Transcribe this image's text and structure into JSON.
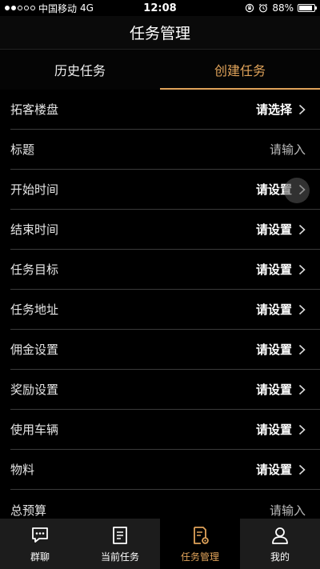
{
  "status_bar": {
    "carrier": "中国移动",
    "network": "4G",
    "time": "12:08",
    "battery": "88%",
    "battery_level": 0.88
  },
  "nav": {
    "title": "任务管理"
  },
  "tabs": [
    {
      "label": "历史任务",
      "active": false
    },
    {
      "label": "创建任务",
      "active": true
    }
  ],
  "accent_color": "#e0a35a",
  "form": {
    "rows": [
      {
        "label": "拓客楼盘",
        "value": "请选择",
        "kind": "select"
      },
      {
        "label": "标题",
        "value": "请输入",
        "kind": "input"
      },
      {
        "label": "开始时间",
        "value": "请设置",
        "kind": "select"
      },
      {
        "label": "结束时间",
        "value": "请设置",
        "kind": "select"
      },
      {
        "label": "任务目标",
        "value": "请设置",
        "kind": "select"
      },
      {
        "label": "任务地址",
        "value": "请设置",
        "kind": "select"
      },
      {
        "label": "佣金设置",
        "value": "请设置",
        "kind": "select"
      },
      {
        "label": "奖励设置",
        "value": "请设置",
        "kind": "select"
      },
      {
        "label": "使用车辆",
        "value": "请设置",
        "kind": "select"
      },
      {
        "label": "物料",
        "value": "请设置",
        "kind": "select"
      },
      {
        "label": "总预算",
        "value": "请输入",
        "kind": "input"
      }
    ]
  },
  "tabbar": {
    "items": [
      {
        "label": "群聊",
        "icon": "chat-icon",
        "active": false
      },
      {
        "label": "当前任务",
        "icon": "document-icon",
        "active": false
      },
      {
        "label": "任务管理",
        "icon": "task-settings-icon",
        "active": true
      },
      {
        "label": "我的",
        "icon": "person-icon",
        "active": false
      }
    ]
  }
}
